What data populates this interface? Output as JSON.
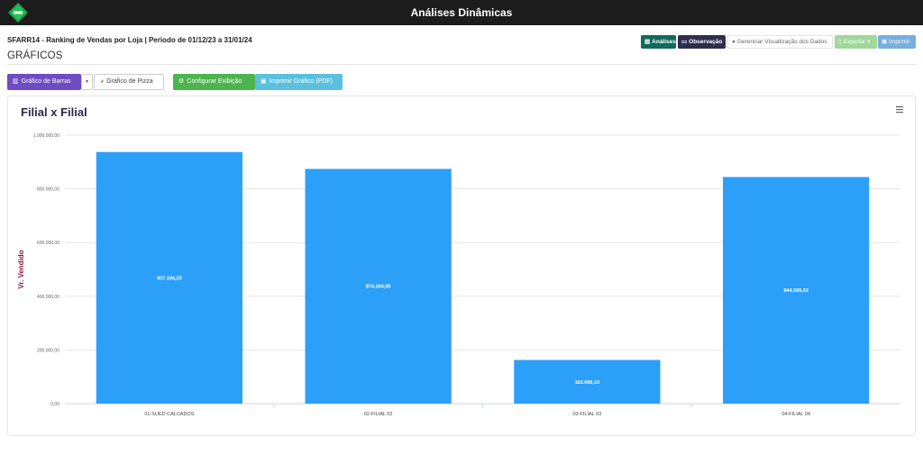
{
  "app": {
    "title": "Análises Dinâmicas",
    "logo_icon": "ecommerce-logo-icon"
  },
  "report": {
    "title": "SFARR14 - Ranking de Vendas por Loja | Periodo de 01/12/23 a 31/01/24",
    "section": "GRÁFICOS"
  },
  "toolbar": {
    "analises": "Análises",
    "observacao": "Observação",
    "gerenciar": "Gerenciar Visualização dos Dados",
    "exportar": "Exportar",
    "imprimir": "Imprimir"
  },
  "chart_toolbar": {
    "barras": "Gráfico de Barras",
    "pizza": "Gráfico de Pizza",
    "configurar": "Configurar Exibição",
    "imprimir_pdf": "Imprimir Gráfico (PDF)"
  },
  "colors": {
    "bar": "#2c9ff8",
    "ylabel": "#8b1e3f",
    "title": "#2b2a4a"
  },
  "chart_data": {
    "type": "bar",
    "title": "Filial x Filial",
    "xlabel": "",
    "ylabel": "Vr. Vendido",
    "categories": [
      "01-SUED CALCADOS",
      "02-FILIAL 02",
      "03-FILIAL 03",
      "04-FILIAL 04"
    ],
    "values": [
      937194.25,
      874204.95,
      162690.1,
      844099.62
    ],
    "value_labels": [
      "937.194,25",
      "874.204,95",
      "162.690,10",
      "844.099,62"
    ],
    "ylim": [
      0,
      1000000
    ],
    "yticks": [
      0,
      200000,
      400000,
      600000,
      800000,
      1000000
    ],
    "ytick_labels": [
      "0,00",
      "200.000,00",
      "400.000,00",
      "600.000,00",
      "800.000,00",
      "1.000.000,00"
    ],
    "grid": true,
    "legend": "none"
  }
}
